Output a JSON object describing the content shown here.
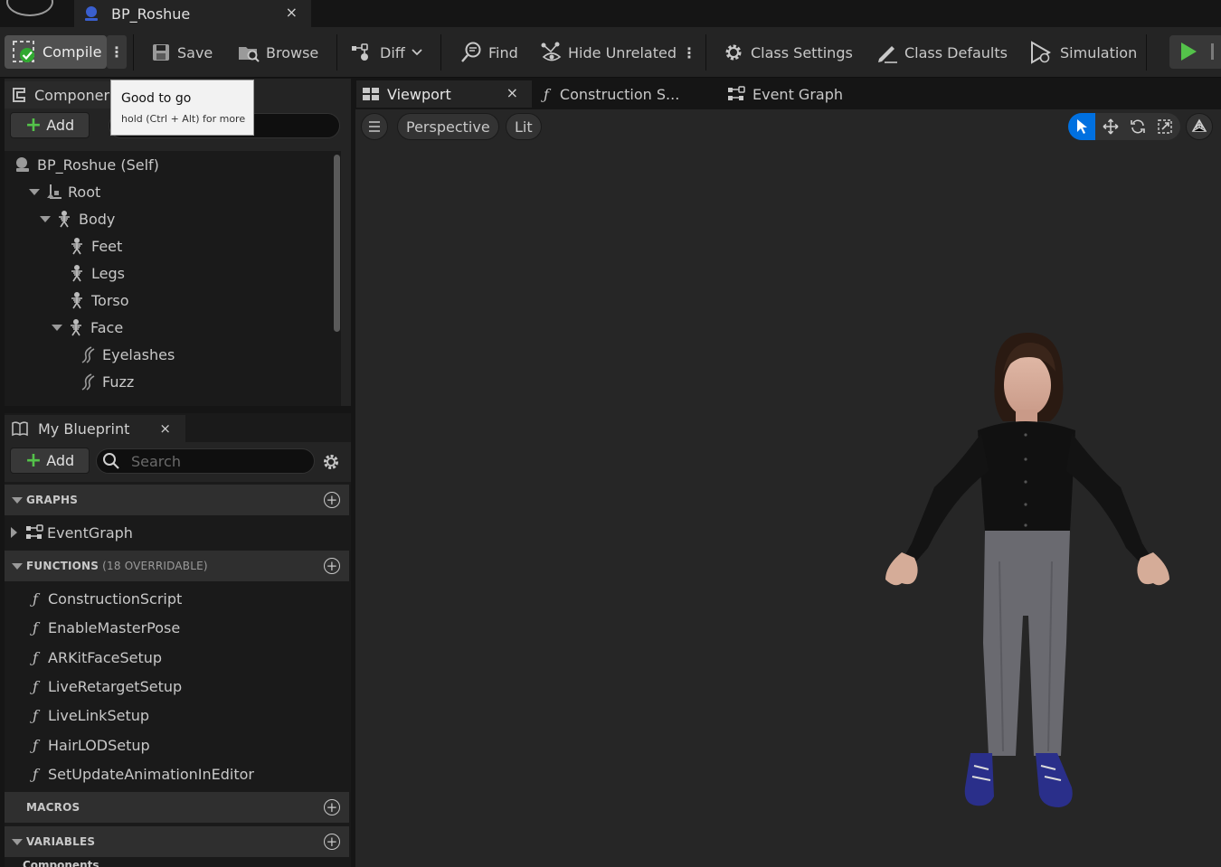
{
  "window": {
    "tab_title": "BP_Roshue",
    "close_glyph": "×"
  },
  "toolbar": {
    "compile_label": "Compile",
    "save_label": "Save",
    "browse_label": "Browse",
    "diff_label": "Diff",
    "find_label": "Find",
    "hide_unrelated_label": "Hide Unrelated",
    "class_settings_label": "Class Settings",
    "class_defaults_label": "Class Defaults",
    "simulation_label": "Simulation",
    "more_glyph": "⋮"
  },
  "tooltip": {
    "title": "Good to go",
    "hint": "hold (Ctrl + Alt) for more"
  },
  "components": {
    "tab_label": "Componer",
    "add_label": "Add",
    "tree": [
      {
        "label": "BP_Roshue (Self)",
        "icon": "blueprint-self-icon"
      },
      {
        "label": "Root",
        "icon": "root-scene-icon"
      },
      {
        "label": "Body",
        "icon": "skeletal-mesh-icon"
      },
      {
        "label": "Feet",
        "icon": "skeletal-mesh-icon"
      },
      {
        "label": "Legs",
        "icon": "skeletal-mesh-icon"
      },
      {
        "label": "Torso",
        "icon": "skeletal-mesh-icon"
      },
      {
        "label": "Face",
        "icon": "skeletal-mesh-icon"
      },
      {
        "label": "Eyelashes",
        "icon": "groom-icon"
      },
      {
        "label": "Fuzz",
        "icon": "groom-icon"
      }
    ]
  },
  "my_blueprint": {
    "tab_label": "My Blueprint",
    "add_label": "Add",
    "search_placeholder": "Search",
    "graphs_header": "GRAPHS",
    "graphs": [
      "EventGraph"
    ],
    "functions_header": "FUNCTIONS",
    "functions_sub": "(18 OVERRIDABLE)",
    "functions": [
      "ConstructionScript",
      "EnableMasterPose",
      "ARKitFaceSetup",
      "LiveRetargetSetup",
      "LiveLinkSetup",
      "HairLODSetup",
      "SetUpdateAnimationInEditor"
    ],
    "macros_header": "MACROS",
    "variables_header": "VARIABLES",
    "variables_first": "Components"
  },
  "editor_tabs": {
    "viewport": "Viewport",
    "construction": "Construction S...",
    "event_graph": "Event Graph"
  },
  "viewport": {
    "perspective_label": "Perspective",
    "lit_label": "Lit"
  },
  "colors": {
    "accent_blue": "#0070e0",
    "play_green": "#54c24a",
    "compile_ok_green": "#2fa82f"
  }
}
